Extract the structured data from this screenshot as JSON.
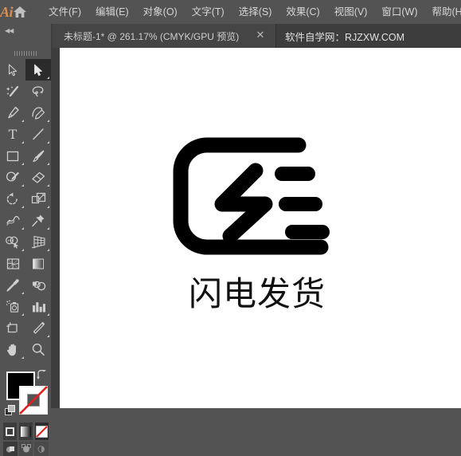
{
  "app": {
    "logo_text": "Ai",
    "logo_color": "#d98f4e",
    "home_icon": "home-icon"
  },
  "menu": {
    "items": [
      {
        "label": "文件(F)",
        "name": "menu-file"
      },
      {
        "label": "编辑(E)",
        "name": "menu-edit"
      },
      {
        "label": "对象(O)",
        "name": "menu-object"
      },
      {
        "label": "文字(T)",
        "name": "menu-type"
      },
      {
        "label": "选择(S)",
        "name": "menu-select"
      },
      {
        "label": "效果(C)",
        "name": "menu-effect"
      },
      {
        "label": "视图(V)",
        "name": "menu-view"
      },
      {
        "label": "窗口(W)",
        "name": "menu-window"
      },
      {
        "label": "帮助(H)",
        "name": "menu-help"
      }
    ]
  },
  "tabbar": {
    "collapse_arrows": "◀◀",
    "document_tab": {
      "title": "未标题-1* @ 261.17% (CMYK/GPU 预览)",
      "close_label": "✕"
    },
    "site_label": "软件自学网：RJZXW.COM"
  },
  "toolbar": {
    "tools": [
      {
        "name": "selection-tool",
        "icon": "arrow-outline-icon",
        "active": false,
        "has_flyout": false
      },
      {
        "name": "direct-selection-tool",
        "icon": "arrow-filled-icon",
        "active": true,
        "has_flyout": true
      },
      {
        "name": "magic-wand-tool",
        "icon": "magic-wand-icon",
        "active": false,
        "has_flyout": false
      },
      {
        "name": "lasso-tool",
        "icon": "lasso-icon",
        "active": false,
        "has_flyout": false
      },
      {
        "name": "pen-tool",
        "icon": "pen-icon",
        "active": false,
        "has_flyout": true
      },
      {
        "name": "curvature-tool",
        "icon": "curvature-icon",
        "active": false,
        "has_flyout": true
      },
      {
        "name": "type-tool",
        "icon": "type-T-icon",
        "active": false,
        "has_flyout": true
      },
      {
        "name": "line-segment-tool",
        "icon": "line-segment-icon",
        "active": false,
        "has_flyout": true
      },
      {
        "name": "rectangle-tool",
        "icon": "rectangle-icon",
        "active": false,
        "has_flyout": true
      },
      {
        "name": "paintbrush-tool",
        "icon": "paintbrush-icon",
        "active": false,
        "has_flyout": true
      },
      {
        "name": "shaper-tool",
        "icon": "shaper-pencil-icon",
        "active": false,
        "has_flyout": true
      },
      {
        "name": "eraser-tool",
        "icon": "eraser-icon",
        "active": false,
        "has_flyout": true
      },
      {
        "name": "rotate-tool",
        "icon": "rotate-icon",
        "active": false,
        "has_flyout": true
      },
      {
        "name": "scale-tool",
        "icon": "scale-icon",
        "active": false,
        "has_flyout": true
      },
      {
        "name": "width-tool",
        "icon": "width-warp-icon",
        "active": false,
        "has_flyout": true
      },
      {
        "name": "free-transform-tool",
        "icon": "pushpin-icon",
        "active": false,
        "has_flyout": true
      },
      {
        "name": "shape-builder-tool",
        "icon": "shape-builder-icon",
        "active": false,
        "has_flyout": true
      },
      {
        "name": "perspective-grid-tool",
        "icon": "perspective-grid-icon",
        "active": false,
        "has_flyout": true
      },
      {
        "name": "mesh-tool",
        "icon": "mesh-icon",
        "active": false,
        "has_flyout": false
      },
      {
        "name": "gradient-tool",
        "icon": "gradient-icon",
        "active": false,
        "has_flyout": false
      },
      {
        "name": "eyedropper-tool",
        "icon": "eyedropper-icon",
        "active": false,
        "has_flyout": true
      },
      {
        "name": "blend-tool",
        "icon": "blend-icon",
        "active": false,
        "has_flyout": false
      },
      {
        "name": "symbol-sprayer-tool",
        "icon": "symbol-sprayer-icon",
        "active": false,
        "has_flyout": true
      },
      {
        "name": "column-graph-tool",
        "icon": "bar-graph-icon",
        "active": false,
        "has_flyout": true
      },
      {
        "name": "artboard-tool",
        "icon": "artboard-icon",
        "active": false,
        "has_flyout": false
      },
      {
        "name": "slice-tool",
        "icon": "slice-knife-icon",
        "active": false,
        "has_flyout": true
      },
      {
        "name": "hand-tool",
        "icon": "hand-icon",
        "active": false,
        "has_flyout": true
      },
      {
        "name": "zoom-tool",
        "icon": "magnifier-icon",
        "active": false,
        "has_flyout": false
      }
    ],
    "fill_color": "#000000",
    "stroke_color": "none",
    "swap_icon": "swap-arrow-icon",
    "default_icon": "default-fill-stroke-icon",
    "paint_modes": [
      {
        "name": "color-mode-button",
        "icon": "solid-color-icon",
        "selected": false
      },
      {
        "name": "gradient-mode-button",
        "icon": "gradient-swatch-icon",
        "selected": false
      },
      {
        "name": "none-mode-button",
        "icon": "none-slash-icon",
        "selected": true
      }
    ],
    "draw_modes": [
      {
        "name": "draw-normal-button",
        "icon": "draw-normal-icon",
        "selected": true
      },
      {
        "name": "draw-behind-button",
        "icon": "draw-behind-icon",
        "selected": false
      },
      {
        "name": "draw-inside-button",
        "icon": "draw-inside-icon",
        "selected": false
      }
    ]
  },
  "canvas": {
    "background": "#ffffff",
    "artwork": {
      "name": "lightning-delivery-logo",
      "description": "rounded open rectangle with lightning bolt and three staggered speed lines",
      "stroke_color": "#000000",
      "caption": "闪电发货"
    }
  }
}
